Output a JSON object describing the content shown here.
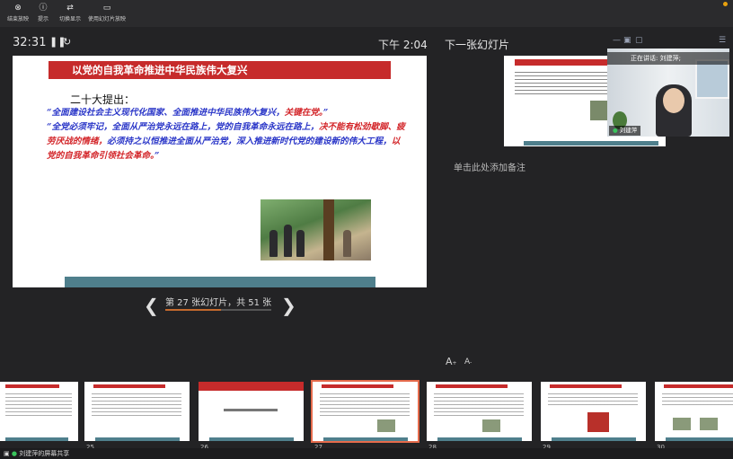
{
  "toolbar": {
    "buttons": [
      {
        "label": "结束放映",
        "icon": "close-circle-icon"
      },
      {
        "label": "提示",
        "icon": "info-icon"
      },
      {
        "label": "切换显示",
        "icon": "swap-icon"
      },
      {
        "label": "使用幻灯片放映",
        "icon": "slideshow-icon"
      }
    ]
  },
  "presenter": {
    "timer": "32:31",
    "pause_icon": "pause-icon",
    "reset_icon": "reset-icon",
    "clock": "下午 2:04",
    "next_slide_label": "下一张幻灯片",
    "notes_placeholder": "单击此处添加备注",
    "slide_counter": "第 27 张幻灯片，共 51 张",
    "current_slide": 27,
    "total_slides": 51,
    "progress_fraction": 0.529
  },
  "slide": {
    "title": "以党的自我革命推进中华民族伟大复兴",
    "lead": "二十大提出：",
    "p1_blue": "“全面建设社会主义现代化国家、全面推进中华民族伟大复兴，",
    "p1_red": "关键在党。",
    "p1_end": "”",
    "p2_blue": "“全党必须牢记，全面从严治党永远在路上，党的自我革命永远在路上，",
    "p2_red": "决不能有松劲歇脚、疲劳厌战的情绪，",
    "p2_blue2": "必须持之以恒推进全面从严治党，深入推进新时代党的建设新的伟大工程，",
    "p2_red2": "以党的自我革命引领社会革命。",
    "p2_end": "”"
  },
  "next_slide": {
    "title_text": "识党的自我革命引领社会革命是一条党",
    "body_text": "一百年来，中国共产党敢于自我革命，打败了日本帝国主义，推翻国民党反动统治，完成了新民主主义革命。"
  },
  "video": {
    "speaking_label": "正在讲话: 刘建萍;",
    "name": "刘建萍"
  },
  "thumbnails": [
    {
      "num": "",
      "title": "大局”  主要大变局中的全会精神"
    },
    {
      "num": "25",
      "title": "二十大报告“三个务必”，深刻阐述"
    },
    {
      "num": "26",
      "title": "三、以党的自我革命引领社会革命"
    },
    {
      "num": "27",
      "title": "以党的自我革命推进中华民族伟大复兴"
    },
    {
      "num": "28",
      "title": "以党的自我革命引领社会革命是一条党"
    },
    {
      "num": "29",
      "title": "“历史周期率”问题的答案"
    },
    {
      "num": "30",
      "title": "“二个务必”"
    }
  ],
  "bottom": {
    "share_label": "刘建萍的屏幕共享"
  },
  "font_controls": {
    "increase": "A",
    "decrease": "A"
  }
}
